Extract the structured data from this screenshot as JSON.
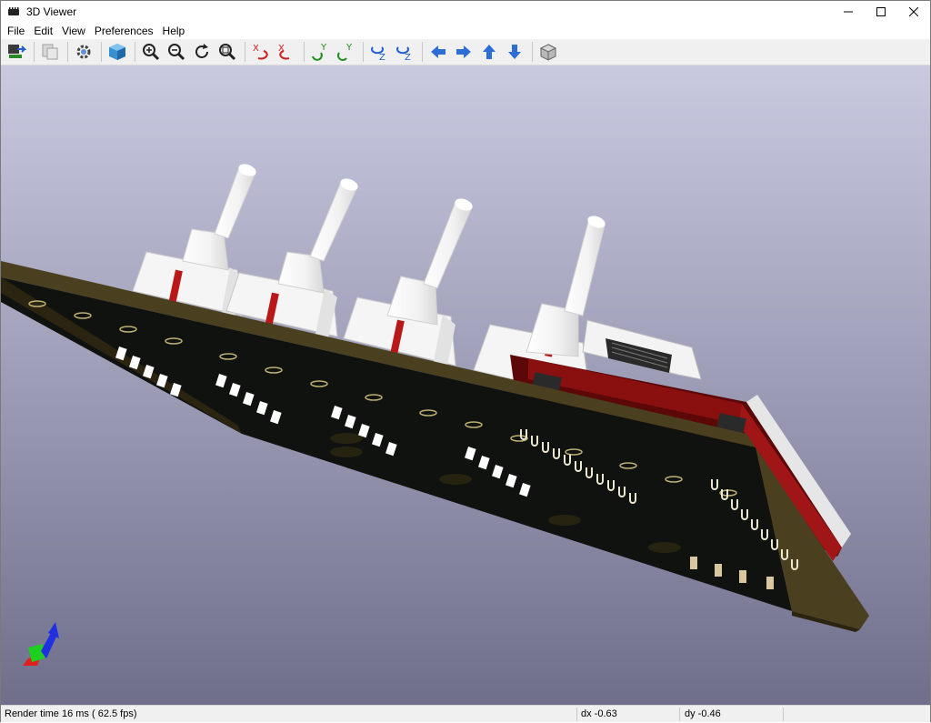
{
  "window": {
    "title": "3D Viewer",
    "icon": "pcb-chip-icon"
  },
  "menu": {
    "items": [
      "File",
      "Edit",
      "View",
      "Preferences",
      "Help"
    ]
  },
  "toolbar": {
    "buttons": [
      {
        "icon": "reload-board-icon",
        "tooltip": ""
      },
      {
        "icon": "copy-image-icon",
        "tooltip": ""
      },
      {
        "icon": "settings-gear-icon",
        "tooltip": ""
      },
      {
        "icon": "raytracing-cube-icon",
        "tooltip": ""
      },
      {
        "icon": "zoom-in-icon",
        "tooltip": ""
      },
      {
        "icon": "zoom-out-icon",
        "tooltip": ""
      },
      {
        "icon": "redraw-icon",
        "tooltip": ""
      },
      {
        "icon": "zoom-fit-icon",
        "tooltip": ""
      },
      {
        "icon": "rotate-x-cw-icon",
        "tooltip": ""
      },
      {
        "icon": "rotate-x-ccw-icon",
        "tooltip": ""
      },
      {
        "icon": "rotate-y-cw-icon",
        "tooltip": ""
      },
      {
        "icon": "rotate-y-ccw-icon",
        "tooltip": ""
      },
      {
        "icon": "rotate-z-cw-icon",
        "tooltip": ""
      },
      {
        "icon": "rotate-z-ccw-icon",
        "tooltip": ""
      },
      {
        "icon": "pan-left-icon",
        "tooltip": ""
      },
      {
        "icon": "pan-right-icon",
        "tooltip": ""
      },
      {
        "icon": "pan-up-icon",
        "tooltip": ""
      },
      {
        "icon": "pan-down-icon",
        "tooltip": ""
      },
      {
        "icon": "ortho-view-icon",
        "tooltip": ""
      }
    ],
    "axis_letters": {
      "x": "X",
      "y": "Y",
      "z": "Z"
    }
  },
  "colors": {
    "background_top": "#c9c9e0",
    "background_bottom": "#6f6f8c",
    "board_edge": "#4a3f1e",
    "board_bottom": "#0f120f",
    "silkscreen": "#ffffff",
    "pads": "#e8d68a",
    "connector_red": "#6e0b0b",
    "accent_blue": "#2d6ed6",
    "axis_red": "#e0201c",
    "axis_green": "#1fcf1f",
    "axis_blue": "#2030e0"
  },
  "status": {
    "render_time": "Render time 16 ms ( 62.5 fps)",
    "dx": "dx -0.63",
    "dy": "dy -0.46"
  }
}
